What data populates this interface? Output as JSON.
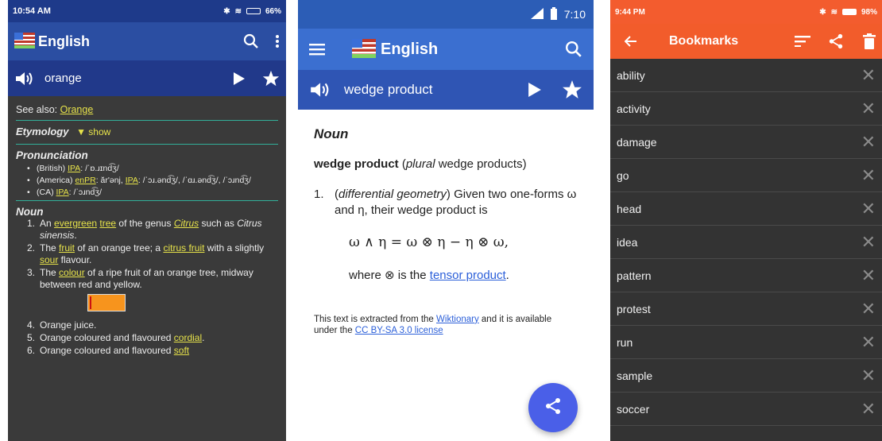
{
  "phone1": {
    "status": {
      "time": "10:54 AM",
      "battery": "66%"
    },
    "appbar": {
      "title": "English"
    },
    "wordbar": {
      "word": "orange"
    },
    "see_also": {
      "label": "See also: ",
      "link": "Orange"
    },
    "etymology": {
      "label": "Etymology",
      "toggle": "▼ show"
    },
    "pronunciation": {
      "heading": "Pronunciation",
      "items": [
        {
          "region": "(British)",
          "ipa_label": "IPA",
          "text": ": /ˈɒ.ɹɪnd͡ʒ/"
        },
        {
          "region": "(America)",
          "enpr_label": "enPR",
          "text1": ": ăr'ənj, ",
          "ipa_label": "IPA",
          "text2": ": /ˈɔɹ.ənd͡ʒ/, /ˈɑɹ.ənd͡ʒ/, /ˈɔɹnd͡ʒ/"
        },
        {
          "region": "(CA)",
          "ipa_label": "IPA",
          "text": ": /ˈɔɹnd͡ʒ/"
        }
      ]
    },
    "noun": {
      "heading": "Noun",
      "senses": [
        {
          "num": "1.",
          "parts": [
            "An ",
            "evergreen",
            " ",
            "tree",
            " of the genus ",
            "Citrus",
            " such as ",
            "Citrus sinensis",
            "."
          ]
        },
        {
          "num": "2.",
          "parts": [
            "The ",
            "fruit",
            " of an orange tree; a ",
            "citrus fruit",
            " with a slightly ",
            "sour",
            " flavour."
          ]
        },
        {
          "num": "3.",
          "parts": [
            "The ",
            "colour",
            " of a ripe fruit of an orange tree, midway between red and yellow."
          ]
        },
        {
          "num": "4.",
          "text": "Orange juice."
        },
        {
          "num": "5.",
          "text": "Orange coloured and flavoured ",
          "link": "cordial",
          "tail": "."
        },
        {
          "num": "6.",
          "text": "Orange coloured and flavoured ",
          "link": "soft"
        }
      ]
    }
  },
  "phone2": {
    "status": {
      "time": "7:10"
    },
    "appbar": {
      "title": "English"
    },
    "wordbar": {
      "word": "wedge product"
    },
    "pos": "Noun",
    "headword": {
      "word": "wedge product",
      "plural_label": "plural",
      "plural": "wedge products"
    },
    "sense": {
      "num": "1.",
      "domain": "differential geometry",
      "text": "Given two one-forms ω and η, their wedge product is"
    },
    "formula": "ω ∧ η = ω ⊗ η − η ⊗ ω,",
    "where": {
      "text": "where ⊗ is the ",
      "link": "tensor product",
      "tail": "."
    },
    "footer": {
      "t1": "This text is extracted from the ",
      "link1": "Wiktionary",
      "t2": " and it is available under the ",
      "link2": "CC BY-SA 3.0 license"
    }
  },
  "phone3": {
    "status": {
      "time": "9:44 PM",
      "battery": "98%"
    },
    "appbar": {
      "title": "Bookmarks"
    },
    "bookmarks": [
      "ability",
      "activity",
      "damage",
      "go",
      "head",
      "idea",
      "pattern",
      "protest",
      "run",
      "sample",
      "soccer"
    ]
  },
  "colors": {
    "blue_bar": "#2b4ea2",
    "orange_bar": "#f25c2b",
    "link_yellow": "#e6e24a",
    "fab": "#4a5fe8"
  }
}
